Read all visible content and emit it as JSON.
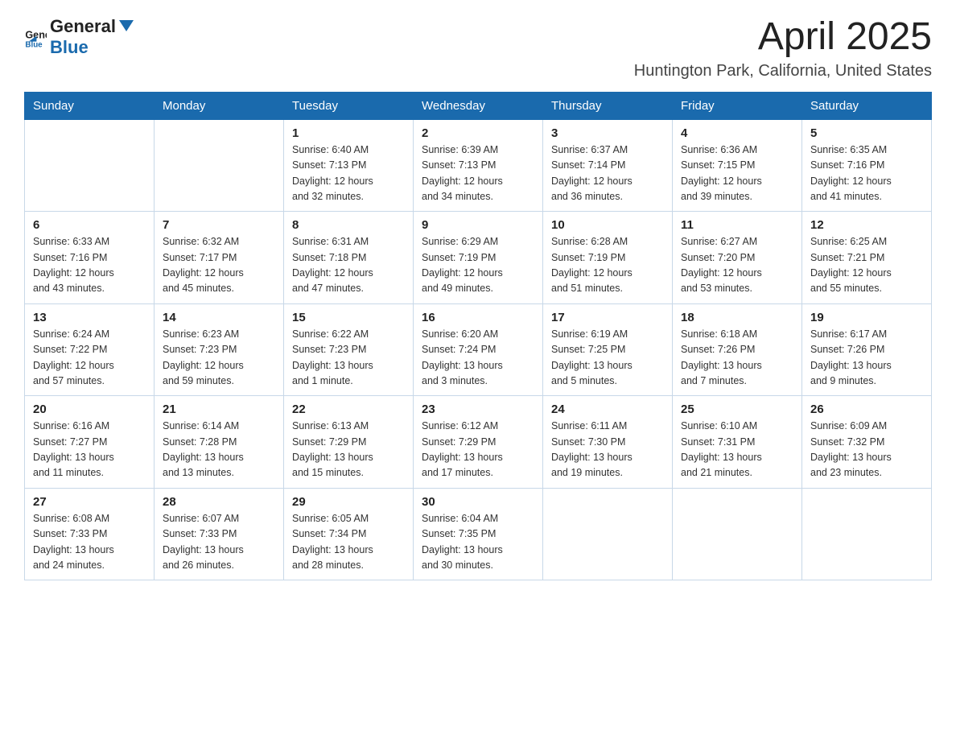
{
  "header": {
    "logo": {
      "text_general": "General",
      "text_blue": "Blue",
      "icon_alt": "GeneralBlue logo"
    },
    "month_year": "April 2025",
    "location": "Huntington Park, California, United States"
  },
  "calendar": {
    "days_of_week": [
      "Sunday",
      "Monday",
      "Tuesday",
      "Wednesday",
      "Thursday",
      "Friday",
      "Saturday"
    ],
    "weeks": [
      [
        {
          "day": "",
          "info": ""
        },
        {
          "day": "",
          "info": ""
        },
        {
          "day": "1",
          "info": "Sunrise: 6:40 AM\nSunset: 7:13 PM\nDaylight: 12 hours\nand 32 minutes."
        },
        {
          "day": "2",
          "info": "Sunrise: 6:39 AM\nSunset: 7:13 PM\nDaylight: 12 hours\nand 34 minutes."
        },
        {
          "day": "3",
          "info": "Sunrise: 6:37 AM\nSunset: 7:14 PM\nDaylight: 12 hours\nand 36 minutes."
        },
        {
          "day": "4",
          "info": "Sunrise: 6:36 AM\nSunset: 7:15 PM\nDaylight: 12 hours\nand 39 minutes."
        },
        {
          "day": "5",
          "info": "Sunrise: 6:35 AM\nSunset: 7:16 PM\nDaylight: 12 hours\nand 41 minutes."
        }
      ],
      [
        {
          "day": "6",
          "info": "Sunrise: 6:33 AM\nSunset: 7:16 PM\nDaylight: 12 hours\nand 43 minutes."
        },
        {
          "day": "7",
          "info": "Sunrise: 6:32 AM\nSunset: 7:17 PM\nDaylight: 12 hours\nand 45 minutes."
        },
        {
          "day": "8",
          "info": "Sunrise: 6:31 AM\nSunset: 7:18 PM\nDaylight: 12 hours\nand 47 minutes."
        },
        {
          "day": "9",
          "info": "Sunrise: 6:29 AM\nSunset: 7:19 PM\nDaylight: 12 hours\nand 49 minutes."
        },
        {
          "day": "10",
          "info": "Sunrise: 6:28 AM\nSunset: 7:19 PM\nDaylight: 12 hours\nand 51 minutes."
        },
        {
          "day": "11",
          "info": "Sunrise: 6:27 AM\nSunset: 7:20 PM\nDaylight: 12 hours\nand 53 minutes."
        },
        {
          "day": "12",
          "info": "Sunrise: 6:25 AM\nSunset: 7:21 PM\nDaylight: 12 hours\nand 55 minutes."
        }
      ],
      [
        {
          "day": "13",
          "info": "Sunrise: 6:24 AM\nSunset: 7:22 PM\nDaylight: 12 hours\nand 57 minutes."
        },
        {
          "day": "14",
          "info": "Sunrise: 6:23 AM\nSunset: 7:23 PM\nDaylight: 12 hours\nand 59 minutes."
        },
        {
          "day": "15",
          "info": "Sunrise: 6:22 AM\nSunset: 7:23 PM\nDaylight: 13 hours\nand 1 minute."
        },
        {
          "day": "16",
          "info": "Sunrise: 6:20 AM\nSunset: 7:24 PM\nDaylight: 13 hours\nand 3 minutes."
        },
        {
          "day": "17",
          "info": "Sunrise: 6:19 AM\nSunset: 7:25 PM\nDaylight: 13 hours\nand 5 minutes."
        },
        {
          "day": "18",
          "info": "Sunrise: 6:18 AM\nSunset: 7:26 PM\nDaylight: 13 hours\nand 7 minutes."
        },
        {
          "day": "19",
          "info": "Sunrise: 6:17 AM\nSunset: 7:26 PM\nDaylight: 13 hours\nand 9 minutes."
        }
      ],
      [
        {
          "day": "20",
          "info": "Sunrise: 6:16 AM\nSunset: 7:27 PM\nDaylight: 13 hours\nand 11 minutes."
        },
        {
          "day": "21",
          "info": "Sunrise: 6:14 AM\nSunset: 7:28 PM\nDaylight: 13 hours\nand 13 minutes."
        },
        {
          "day": "22",
          "info": "Sunrise: 6:13 AM\nSunset: 7:29 PM\nDaylight: 13 hours\nand 15 minutes."
        },
        {
          "day": "23",
          "info": "Sunrise: 6:12 AM\nSunset: 7:29 PM\nDaylight: 13 hours\nand 17 minutes."
        },
        {
          "day": "24",
          "info": "Sunrise: 6:11 AM\nSunset: 7:30 PM\nDaylight: 13 hours\nand 19 minutes."
        },
        {
          "day": "25",
          "info": "Sunrise: 6:10 AM\nSunset: 7:31 PM\nDaylight: 13 hours\nand 21 minutes."
        },
        {
          "day": "26",
          "info": "Sunrise: 6:09 AM\nSunset: 7:32 PM\nDaylight: 13 hours\nand 23 minutes."
        }
      ],
      [
        {
          "day": "27",
          "info": "Sunrise: 6:08 AM\nSunset: 7:33 PM\nDaylight: 13 hours\nand 24 minutes."
        },
        {
          "day": "28",
          "info": "Sunrise: 6:07 AM\nSunset: 7:33 PM\nDaylight: 13 hours\nand 26 minutes."
        },
        {
          "day": "29",
          "info": "Sunrise: 6:05 AM\nSunset: 7:34 PM\nDaylight: 13 hours\nand 28 minutes."
        },
        {
          "day": "30",
          "info": "Sunrise: 6:04 AM\nSunset: 7:35 PM\nDaylight: 13 hours\nand 30 minutes."
        },
        {
          "day": "",
          "info": ""
        },
        {
          "day": "",
          "info": ""
        },
        {
          "day": "",
          "info": ""
        }
      ]
    ]
  }
}
